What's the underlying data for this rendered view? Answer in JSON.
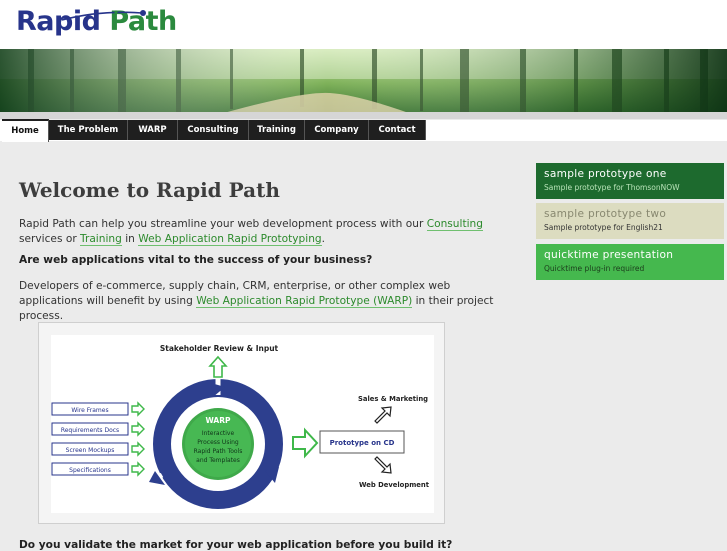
{
  "logo": {
    "word1": "Rapid",
    "word2": "Path"
  },
  "nav": {
    "tabs": [
      "Home",
      "The Problem",
      "WARP",
      "Consulting",
      "Training",
      "Company",
      "Contact"
    ],
    "active": "Home"
  },
  "main": {
    "title": "Welcome to Rapid Path",
    "p1_a": "Rapid Path can help you streamline your web development process with our ",
    "p1_link1": "Consulting",
    "p1_b": " services or ",
    "p1_link2": "Training",
    "p1_c": " in ",
    "p1_link3": "Web Application Rapid Prototyping",
    "p1_d": ".",
    "heading": "Are web applications vital to the success of your business?",
    "p2_a": "Developers of e-commerce, supply chain, CRM, enterprise, or other complex web applications will benefit by using ",
    "p2_link": "Web Application Rapid Prototype (WARP)",
    "p2_b": " in their project process.",
    "cut_heading": "Do you validate the market for your web application before you build it?"
  },
  "diagram": {
    "top_label": "Stakeholder Review & Input",
    "inputs": [
      "Wire Frames",
      "Requirements Docs",
      "Screen Mockups",
      "Specifications"
    ],
    "center_title": "WARP",
    "center_lines": [
      "Interactive",
      "Process Using",
      "Rapid Path Tools",
      "and Templates"
    ],
    "output": "Prototype on CD",
    "sales": "Sales & Marketing",
    "webdev": "Web Development"
  },
  "sidebar": [
    {
      "title": "sample prototype one",
      "sub": "Sample prototype for ThomsonNOW"
    },
    {
      "title": "sample prototype two",
      "sub": "Sample prototype for English21"
    },
    {
      "title": "quicktime presentation",
      "sub": "Quicktime plug-in required"
    }
  ],
  "colors": {
    "brand_blue": "#27348b",
    "brand_green": "#2b8a3e",
    "nav_bg": "#1f1f1f",
    "link": "#2c8a2c",
    "cycle_blue": "#2d3f8e",
    "arrow_green": "#3fb84a"
  }
}
